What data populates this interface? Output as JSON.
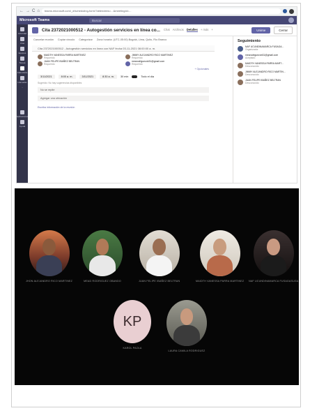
{
  "browser": {
    "nav_glyphs": [
      "←",
      "→",
      "C",
      "⌂"
    ],
    "url": "teams.microsoft.com/_#/scheduling-form/?attendees=...&meetingId=..."
  },
  "teams": {
    "app_title": "Microsoft Teams",
    "search_placeholder": "Buscar",
    "rail": [
      {
        "label": "Actividad"
      },
      {
        "label": "Chat"
      },
      {
        "label": "Equipos"
      },
      {
        "label": "Tareas"
      },
      {
        "label": "Calendario"
      },
      {
        "label": "Llamadas"
      },
      {
        "label": "..."
      },
      {
        "label": "Aplicaciones"
      },
      {
        "label": "Ayuda"
      }
    ],
    "meeting": {
      "title": "Cita 2372021000512 - Autogestión servicios en línea co...",
      "tabs": [
        "Chat",
        "Archivos",
        "Detalles",
        "+ más",
        "+"
      ],
      "active_tab": "Detalles",
      "join_label": "Unirse",
      "close_label": "Cerrar"
    },
    "toolbar": [
      "Cancelar reunión",
      "Zona horaria: (UTC-05:00) Bogotá, Lima, Quito, Río Branco",
      "Opciones de reunión",
      "Categorizar",
      "Copiar vínculo"
    ],
    "form": {
      "title_line": "Cita 2372021000512 - Autogestión servicios en línea con NAF fecha 03-11-2021 08:00:00 a. m.",
      "attendees": [
        {
          "name": "MAIDTH VANESSA PARRA MARTINEZ",
          "role": "Requerido"
        },
        {
          "name": "JIMMY ALEJANDRO RICO MARTINEZ",
          "role": "Requerido"
        },
        {
          "name": "JUAN FELIPE IBAÑEZ BELTRAN",
          "role": "Requerido"
        },
        {
          "name": "mearodriguezob31@gmail.com",
          "role": "Requerido"
        }
      ],
      "optional_link": "+ Opcionales",
      "start_date": "3/11/2021",
      "start_time": "8:00 a. m.",
      "end_date": "3/11/2021",
      "end_time": "8:30 a. m.",
      "duration": "30 min",
      "all_day": "Todo el día",
      "suggestion": "Sugerido: No hay sugerencias disponibles",
      "repeat": "No se repite",
      "location_placeholder": "Agregar una ubicación",
      "description_placeholder": "Escriba información de la reunión"
    },
    "tracking": {
      "title": "Seguimiento",
      "people": [
        {
          "name": "NAF UCUNDINAMARCA FUSAGA...",
          "role": "Organizador"
        },
        {
          "name": "mearodriguezob31@gmail.com",
          "role": "Aceptado"
        },
        {
          "name": "MAIDTH VANESSA PARRA MART...",
          "role": "Desconocido"
        },
        {
          "name": "JIMMY ALEJANDRO RICO MARTIN...",
          "role": "Desconocido"
        },
        {
          "name": "JUAN FELIPE IBAÑEZ BELTRAN",
          "role": "Desconocido"
        }
      ]
    }
  },
  "call": {
    "participants": [
      {
        "name": "JHON ALEJANDRO RICO MARTINEZ",
        "bg": "#c0613a",
        "skin": "#8a5a3c",
        "shirt": "#3a3f55"
      },
      {
        "name": "MEAD RODRIGUEZ OBANDO",
        "bg": "#3f6b3a",
        "skin": "#b07a58",
        "shirt": "#e8e8e8"
      },
      {
        "name": "JUAN FELIPE IBAÑEZ BELTRAN",
        "bg": "#d8d2c8",
        "skin": "#9a6e52",
        "shirt": "#f0f0f0"
      },
      {
        "name": "MAIDTH VANESSA PARRA MARTINEZ",
        "bg": "#e6e2da",
        "skin": "#c89c7e",
        "shirt": "#b86a4a"
      },
      {
        "name": "NAF UCUNDINAMARCA FUSAGASUGA",
        "bg": "#2a2424",
        "skin": "#c99a82",
        "shirt": "#1b1b1b"
      },
      {
        "name": "KAROL PAOLA",
        "initials": "KP"
      },
      {
        "name": "LAURA CAMILA RODRIGUEZ",
        "bg": "#8a8a80",
        "skin": "#c89a7e",
        "shirt": "#3b3b3b"
      }
    ]
  }
}
